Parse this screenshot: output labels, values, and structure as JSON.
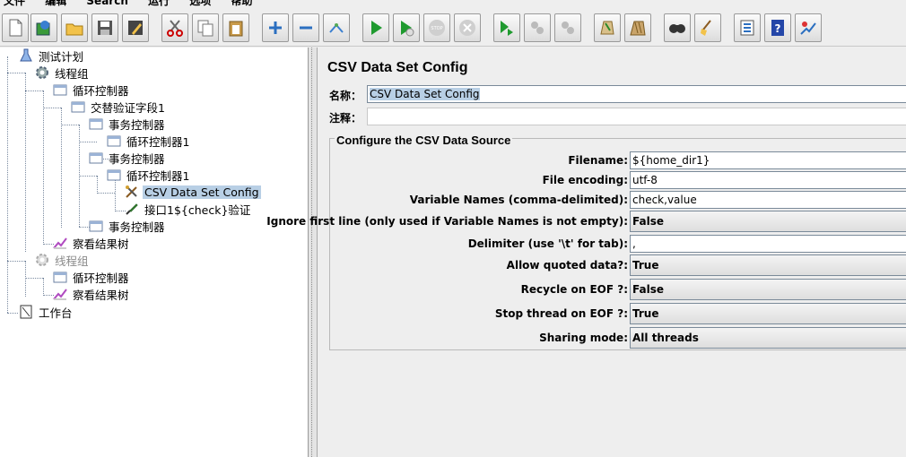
{
  "menubar": {
    "items": [
      "文件",
      "编辑",
      "Search",
      "运行",
      "选项",
      "帮助"
    ]
  },
  "toolbar": {
    "buttons": [
      "new-icon",
      "templates-icon",
      "open-icon",
      "save-icon",
      "save-as-icon",
      "cut-icon",
      "copy-icon",
      "paste-icon",
      "expand-icon",
      "collapse-icon",
      "toggle-icon",
      "start-icon",
      "start-no-pause-icon",
      "stop-icon",
      "shutdown-icon",
      "remote-start-icon",
      "remote-stop-icon",
      "remote-shutdown-icon",
      "clear-icon",
      "clear-all-icon",
      "search-icon",
      "reset-search-icon",
      "function-helper-icon",
      "help-icon",
      "log-viewer-icon"
    ]
  },
  "tree": {
    "nodes": [
      {
        "label": "测试计划",
        "icon": "test-plan-icon"
      },
      {
        "label": "线程组",
        "icon": "thread-group-icon"
      },
      {
        "label": "循环控制器",
        "icon": "controller-icon"
      },
      {
        "label": "交替验证字段1",
        "icon": "controller-icon"
      },
      {
        "label": "事务控制器",
        "icon": "controller-icon"
      },
      {
        "label": "循环控制器1",
        "icon": "controller-icon"
      },
      {
        "label": "事务控制器",
        "icon": "controller-icon"
      },
      {
        "label": "循环控制器1",
        "icon": "controller-icon"
      },
      {
        "label": "CSV Data Set Config",
        "icon": "config-element-icon"
      },
      {
        "label": "接口1${check}验证",
        "icon": "sampler-icon"
      },
      {
        "label": "事务控制器",
        "icon": "controller-icon"
      },
      {
        "label": "察看结果树",
        "icon": "listener-icon"
      },
      {
        "label": "线程组",
        "icon": "thread-group-icon"
      },
      {
        "label": "循环控制器",
        "icon": "controller-icon"
      },
      {
        "label": "察看结果树",
        "icon": "listener-icon"
      },
      {
        "label": "工作台",
        "icon": "workbench-icon"
      }
    ]
  },
  "config": {
    "title": "CSV Data Set Config",
    "name_label": "名称：",
    "name_value": "CSV Data Set Config",
    "comment_label": "注释：",
    "comment_value": "",
    "section_title": "Configure the CSV Data Source",
    "params": [
      {
        "label": "Filename:",
        "value": "${home_dir1}",
        "kind": "text"
      },
      {
        "label": "File encoding:",
        "value": "utf-8",
        "kind": "text"
      },
      {
        "label": "Variable Names (comma-delimited):",
        "value": "check,value",
        "kind": "text"
      },
      {
        "label": "Ignore first line (only used if Variable Names is not empty):",
        "value": "False",
        "kind": "combo"
      },
      {
        "label": "Delimiter (use '\\t' for tab):",
        "value": ",",
        "kind": "text"
      },
      {
        "label": "Allow quoted data?:",
        "value": "True",
        "kind": "combo"
      },
      {
        "label": "Recycle on EOF ?:",
        "value": "False",
        "kind": "combo"
      },
      {
        "label": "Stop thread on EOF ?:",
        "value": "True",
        "kind": "combo"
      },
      {
        "label": "Sharing mode:",
        "value": "All threads",
        "kind": "combo"
      }
    ]
  }
}
